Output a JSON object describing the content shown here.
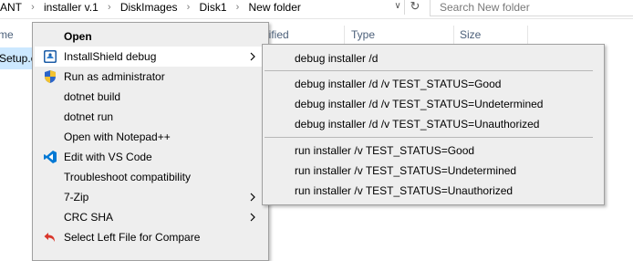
{
  "address_bar": {
    "breadcrumbs": [
      "ANT",
      "installer v.1",
      "DiskImages",
      "Disk1",
      "New folder"
    ],
    "search_placeholder": "Search New folder"
  },
  "file_list": {
    "columns": [
      "me",
      "dified",
      "Type",
      "Size"
    ],
    "selected_file": "Setup.e"
  },
  "context_menu": {
    "items": [
      {
        "label": "Open",
        "bold": true,
        "icon": null,
        "has_submenu": false
      },
      {
        "label": "InstallShield debug",
        "bold": false,
        "icon": "installshield-icon",
        "has_submenu": true,
        "highlighted": true
      },
      {
        "label": "Run as administrator",
        "bold": false,
        "icon": "uac-shield-icon",
        "has_submenu": false
      },
      {
        "label": "dotnet build",
        "bold": false,
        "icon": null,
        "has_submenu": false
      },
      {
        "label": "dotnet run",
        "bold": false,
        "icon": null,
        "has_submenu": false
      },
      {
        "label": "Open with Notepad++",
        "bold": false,
        "icon": null,
        "has_submenu": false
      },
      {
        "label": "Edit with VS Code",
        "bold": false,
        "icon": "vscode-icon",
        "has_submenu": false
      },
      {
        "label": "Troubleshoot compatibility",
        "bold": false,
        "icon": null,
        "has_submenu": false
      },
      {
        "label": "7-Zip",
        "bold": false,
        "icon": null,
        "has_submenu": true
      },
      {
        "label": "CRC SHA",
        "bold": false,
        "icon": null,
        "has_submenu": true
      },
      {
        "label": "Select Left File for Compare",
        "bold": false,
        "icon": "compare-icon",
        "has_submenu": false
      }
    ]
  },
  "submenu": {
    "items": [
      "debug installer /d",
      "debug installer /d /v TEST_STATUS=Good",
      "debug installer /d /v TEST_STATUS=Undetermined",
      "debug installer /d /v TEST_STATUS=Unauthorized",
      "run installer /v TEST_STATUS=Good",
      "run installer /v TEST_STATUS=Undetermined",
      "run installer /v TEST_STATUS=Unauthorized"
    ]
  },
  "colors": {
    "selection": "#cce8ff",
    "menu_bg": "#eeeeee",
    "menu_highlight": "#ffffff",
    "header_text": "#4c607a"
  }
}
